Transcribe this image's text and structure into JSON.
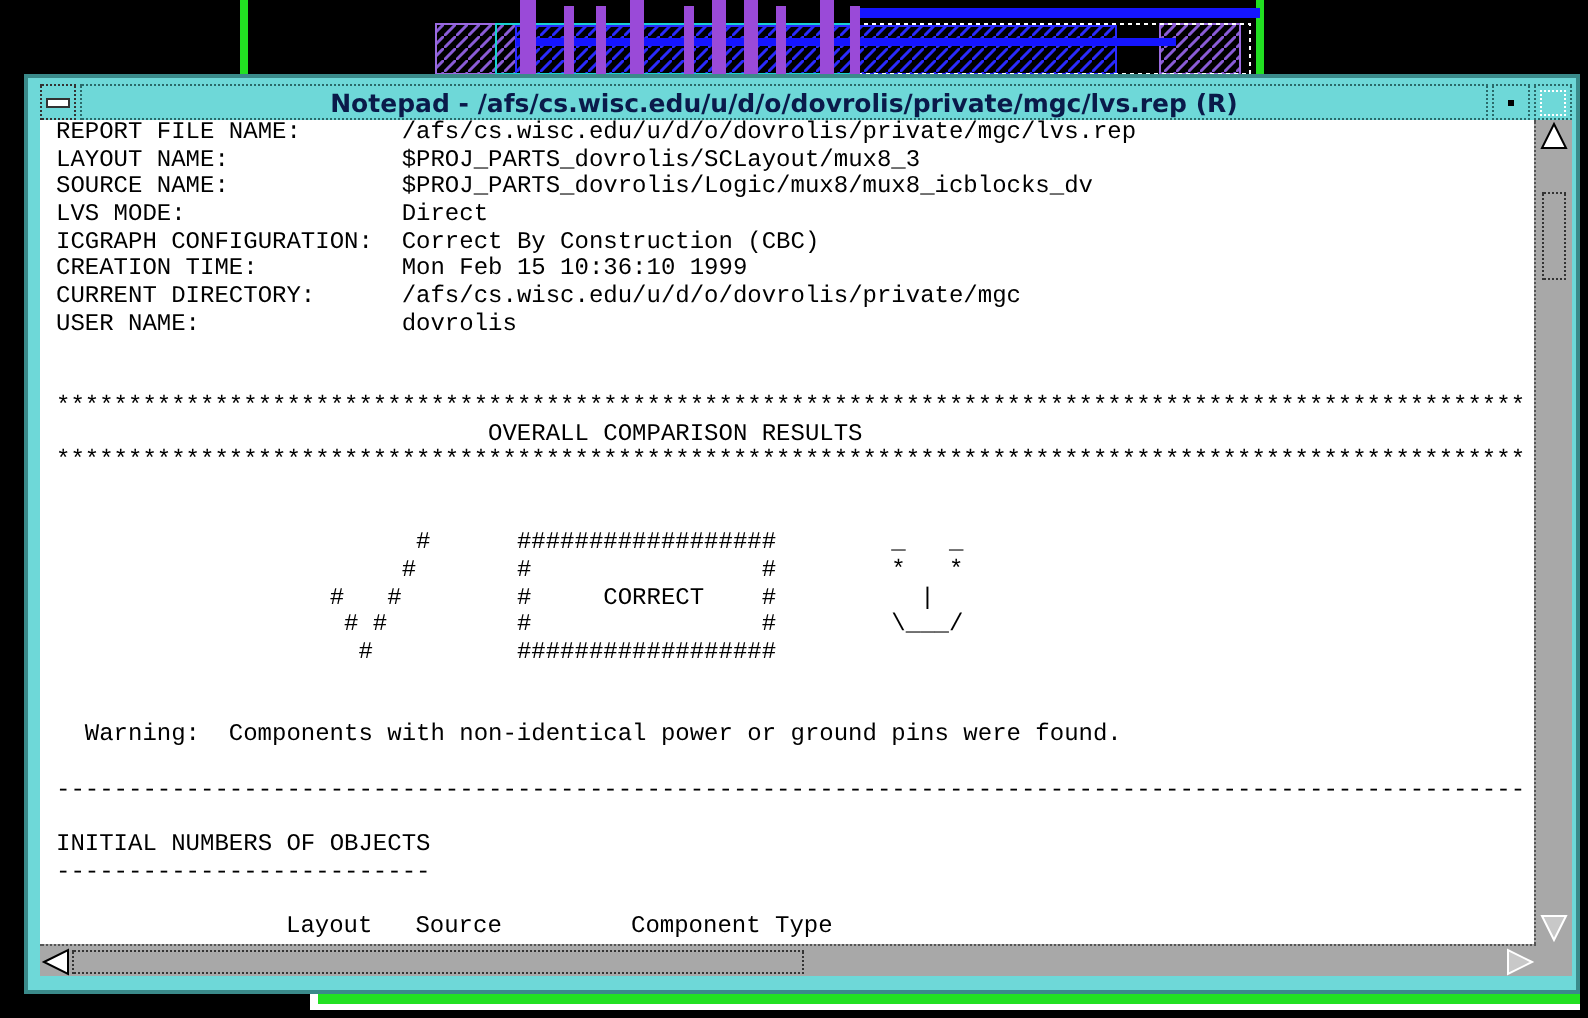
{
  "window": {
    "title": "Notepad - /afs/cs.wisc.edu/u/d/o/dovrolis/private/mgc/lvs.rep (R)",
    "lines": [
      {
        "kind": "field",
        "label": "REPORT FILE NAME:",
        "value": "/afs/cs.wisc.edu/u/d/o/dovrolis/private/mgc/lvs.rep"
      },
      {
        "kind": "field",
        "label": "LAYOUT NAME:",
        "value": "$PROJ_PARTS_dovrolis/SCLayout/mux8_3"
      },
      {
        "kind": "field",
        "label": "SOURCE NAME:",
        "value": "$PROJ_PARTS_dovrolis/Logic/mux8/mux8_icblocks_dv"
      },
      {
        "kind": "field",
        "label": "LVS MODE:",
        "value": "Direct"
      },
      {
        "kind": "field",
        "label": "ICGRAPH CONFIGURATION:",
        "value": "Correct By Construction (CBC)"
      },
      {
        "kind": "field",
        "label": "CREATION TIME:",
        "value": "Mon Feb 15 10:36:10 1999"
      },
      {
        "kind": "field",
        "label": "CURRENT DIRECTORY:",
        "value": "/afs/cs.wisc.edu/u/d/o/dovrolis/private/mgc"
      },
      {
        "kind": "field",
        "label": "USER NAME:",
        "value": "dovrolis"
      },
      {
        "kind": "blank"
      },
      {
        "kind": "blank"
      },
      {
        "kind": "rule",
        "text": "******************************************************************************************************"
      },
      {
        "kind": "heading",
        "text": "OVERALL COMPARISON RESULTS"
      },
      {
        "kind": "rule",
        "text": "******************************************************************************************************"
      },
      {
        "kind": "blank"
      },
      {
        "kind": "blank"
      },
      {
        "kind": "art",
        "text": "                         #      ##################        _   _"
      },
      {
        "kind": "art",
        "text": "                        #       #                #        *   *"
      },
      {
        "kind": "art",
        "text": "                   #   #        #     CORRECT    #          |"
      },
      {
        "kind": "art",
        "text": "                    # #         #                #        \\___/"
      },
      {
        "kind": "art",
        "text": "                     #          ##################"
      },
      {
        "kind": "blank"
      },
      {
        "kind": "blank"
      },
      {
        "kind": "note",
        "text": "Warning:  Components with non-identical power or ground pins were found."
      },
      {
        "kind": "blank"
      },
      {
        "kind": "rule",
        "text": "------------------------------------------------------------------------------------------------------"
      },
      {
        "kind": "blank"
      },
      {
        "kind": "title",
        "text": "INITIAL NUMBERS OF OBJECTS"
      },
      {
        "kind": "rule",
        "text": "--------------------------"
      },
      {
        "kind": "blank"
      },
      {
        "kind": "columns",
        "cells": [
          "Layout",
          "Source",
          "Component Type"
        ]
      }
    ]
  }
}
